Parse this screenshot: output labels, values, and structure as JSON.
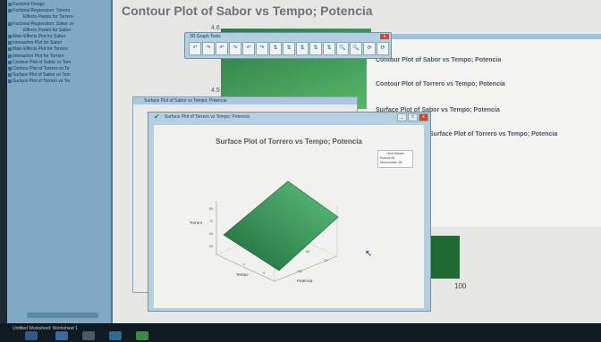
{
  "left_pane": {
    "items": [
      {
        "label": "Factorial Design",
        "sub": false
      },
      {
        "label": "Factorial Regression: Torrero",
        "sub": false
      },
      {
        "label": "Effects Pareto for Torrero",
        "sub": true
      },
      {
        "label": "Factorial Regression: Sabor vs",
        "sub": false
      },
      {
        "label": "Effects Pareto for Sabor",
        "sub": true
      },
      {
        "label": "Main Effects Plot for Sabor",
        "sub": false
      },
      {
        "label": "Interaction Plot for Sabor",
        "sub": false
      },
      {
        "label": "Main Effects Plot for Torrero",
        "sub": false
      },
      {
        "label": "Interaction Plot for Torrero",
        "sub": false
      },
      {
        "label": "Contour Plot of Sabor vs Tem",
        "sub": false
      },
      {
        "label": "Contour Plot of Torrero vs Te",
        "sub": false
      },
      {
        "label": "Surface Plot of Sabor vs Tem",
        "sub": false
      },
      {
        "label": "Surface Plot of Torrero vs Ter",
        "sub": false
      }
    ]
  },
  "main_window": {
    "title": "Contour Plot of Sabor vs Tempo; Potencia",
    "label_a": "4.6",
    "label_b": "4.5",
    "bar_value": "100"
  },
  "graph_list": {
    "items": [
      "Contour Plot of Sabor vs Tempo; Potencia",
      "Contour Plot of Torrero vs Tempo; Potencia",
      "Surface Plot of Sabor vs Tempo; Potencia",
      "Surface Plot of Torrero vs Tempo; Potencia"
    ]
  },
  "toolbar": {
    "title": "3D Graph Tools",
    "close": "x",
    "buttons": [
      "↶",
      "↷",
      "↶",
      "↷",
      "↶",
      "↷",
      "⇅",
      "⇅",
      "⇅",
      "⇅",
      "⇅",
      "🔍",
      "🔍",
      "⟳",
      "⟳"
    ]
  },
  "window_back": {
    "title": "Surface Plot of Sabor vs Tempo; Potencia"
  },
  "window_front": {
    "title": "Surface Plot of Torrero vs Tempo; Potencia",
    "controls": [
      "_",
      "□",
      "x"
    ],
    "plot_title": "Surface Plot of Torrero vs Tempo; Potencia",
    "hold": {
      "header": "Hold Values",
      "row1": "Fuerza     45",
      "row2": "Microondas  -80"
    },
    "axes": {
      "z": "Torrero",
      "x": "Tempo",
      "y": "Potencia",
      "z_ticks": [
        "80",
        "70",
        "60",
        "50"
      ],
      "x_ticks": [
        "4",
        "6"
      ],
      "y_ticks": [
        "50",
        "75",
        "100"
      ]
    }
  },
  "status": {
    "text": "Untitled Worksheet: Worksheet 1"
  },
  "colors": {
    "accent": "#b5cfe2",
    "surface_dark": "#1f6a3a",
    "surface_light": "#5cc17d"
  }
}
